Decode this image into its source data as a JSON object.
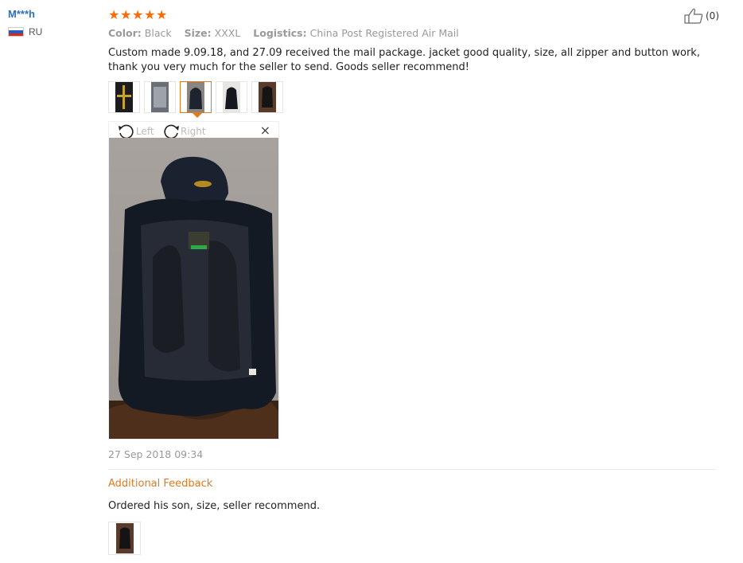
{
  "user": {
    "name": "M***h",
    "country": "RU"
  },
  "rating": {
    "stars": 5
  },
  "helpful": {
    "count": "(0)"
  },
  "attributes": {
    "color_label": "Color:",
    "color_value": "Black",
    "size_label": "Size:",
    "size_value": "XXXL",
    "logistics_label": "Logistics:",
    "logistics_value": "China Post Registered Air Mail"
  },
  "review": {
    "text": "Custom made 9.09.18, and 27.09 received the mail package. jacket good quality, size, all zipper and button work, thank you very much for the seller to send. Goods seller recommend!",
    "date": "27 Sep 2018 09:34"
  },
  "viewer": {
    "rotate_left_label": "Left",
    "rotate_right_label": "Right",
    "close_symbol": "×"
  },
  "additional": {
    "title": "Additional Feedback",
    "text": "Ordered his son, size, seller recommend."
  },
  "colors": {
    "accent": "#e27b1c",
    "user_link": "#2a6fc4",
    "star": "#ff6a00"
  }
}
